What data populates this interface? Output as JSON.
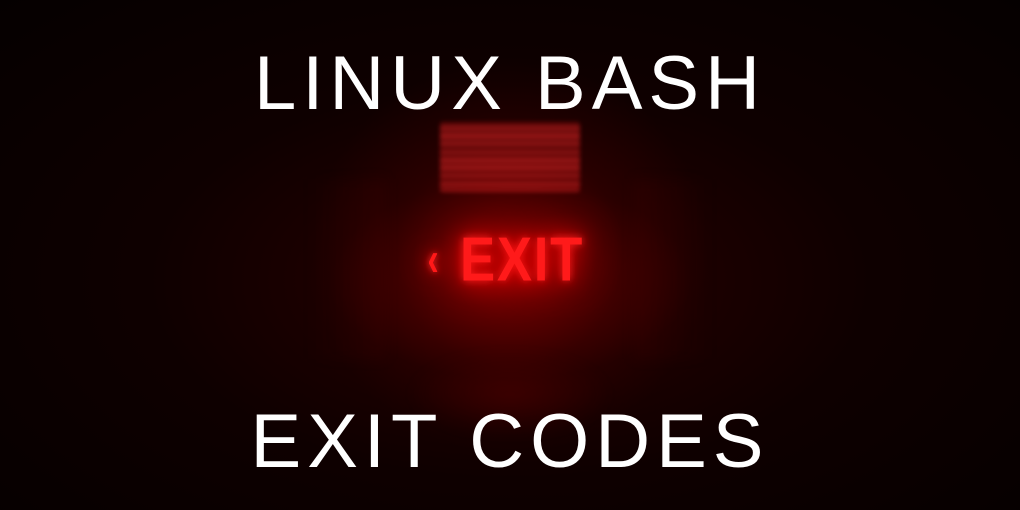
{
  "title": {
    "line1": "LINUX BASH",
    "line2": "EXIT CODES"
  },
  "exit_sign": {
    "arrow": "‹",
    "text": "EXIT"
  },
  "colors": {
    "text": "#ffffff",
    "exit_glow": "#ff1a1a",
    "background": "#050000"
  }
}
